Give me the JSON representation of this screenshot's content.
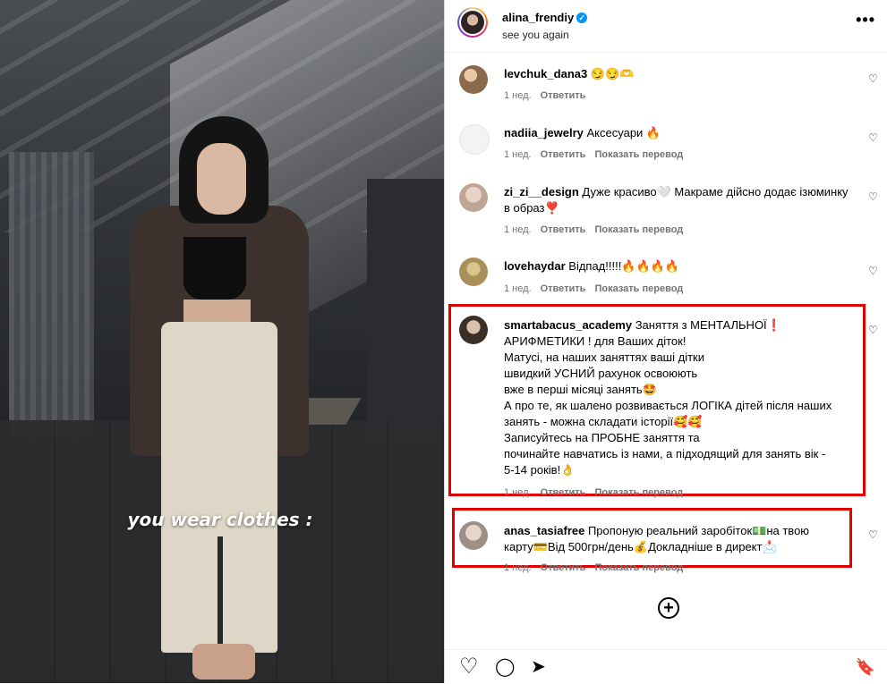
{
  "media": {
    "overlay_text": "you wear clothes :"
  },
  "post": {
    "username": "alina_frendiy",
    "verified": "✓",
    "subtitle": "see you again",
    "more": "•••"
  },
  "comments": [
    {
      "user": "levchuk_dana3",
      "text": " 😏😏🫶",
      "time": "1 нед.",
      "reply": "Ответить",
      "translate": ""
    },
    {
      "user": "nadiia_jewelry",
      "text": " Аксесуари 🔥",
      "time": "1 нед.",
      "reply": "Ответить",
      "translate": "Показать перевод"
    },
    {
      "user": "zi_zi__design",
      "text": " Дуже красиво🤍 Макраме дійсно додає ізюминку в образ❣️",
      "time": "1 нед.",
      "reply": "Ответить",
      "translate": "Показать перевод"
    },
    {
      "user": "lovehaydar",
      "text": " Відпад!!!!!🔥🔥🔥🔥",
      "time": "1 нед.",
      "reply": "Ответить",
      "translate": "Показать перевод"
    },
    {
      "user": "smartabacus_academy",
      "text_lines": [
        " Заняття з МЕНТАЛЬНОЇ❗",
        "АРИФМЕТИКИ ! для Ваших діток!",
        "Матусі, на наших заняттях ваші дітки",
        "швидкий УСНИЙ рахунок освоюють",
        "вже в перші місяці занять🤩",
        "А про те, як шалено розвивається ЛОГІКА дітей після наших",
        "занять - можна складати історії🥰🥰",
        "Записуйтесь на ПРОБНЕ заняття та",
        "починайте навчатись із нами, а підходящий для занять вік -",
        "5-14 років!👌"
      ],
      "time": "1 нед.",
      "reply": "Ответить",
      "translate": "Показать перевод"
    },
    {
      "user": "anas_tasiafree",
      "text_lines": [
        " Пропоную реальний заробіток💵на твою",
        "карту💳Від 500грн/день💰Докладніше в директ📩"
      ],
      "time": "1 нед.",
      "reply": "Ответить",
      "translate": "Показать перевод"
    }
  ],
  "icons": {
    "heart": "♡",
    "add": "+",
    "like": "♡",
    "comment": "◯",
    "share": "➤",
    "save": "🔖"
  },
  "colors": {
    "highlight_border": "#e00000",
    "verified": "#0095f6"
  }
}
